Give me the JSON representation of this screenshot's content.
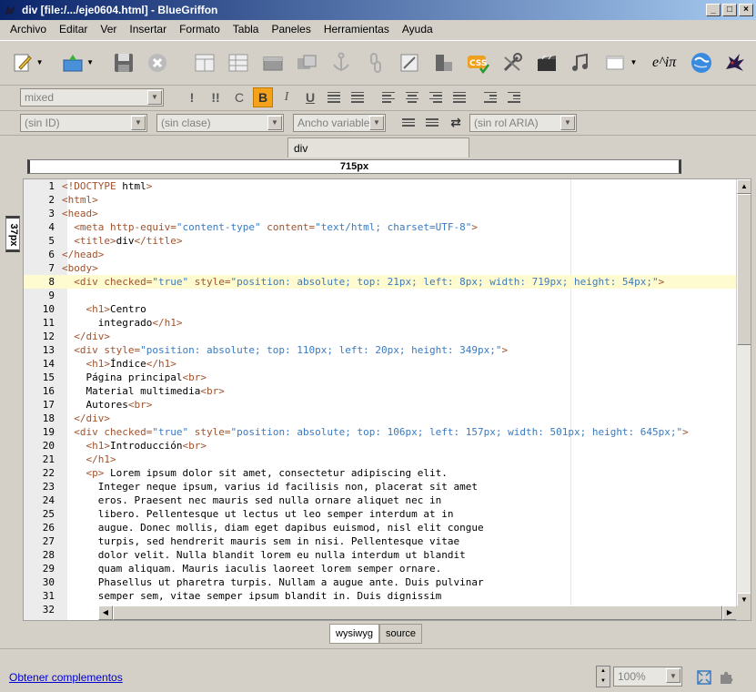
{
  "window": {
    "title": "div [file:/.../eje0604.html] - BlueGriffon"
  },
  "menu": [
    "Archivo",
    "Editar",
    "Ver",
    "Insertar",
    "Formato",
    "Tabla",
    "Paneles",
    "Herramientas",
    "Ayuda"
  ],
  "toolbar": {
    "icons": [
      "new-document-icon",
      "open-document-icon",
      "save-icon",
      "stop-icon",
      "table-icon",
      "table-alt-icon",
      "image-icon",
      "form-icon",
      "anchor-icon",
      "link-icon",
      "edit-image-icon",
      "blocks-icon",
      "css-icon",
      "tools-icon",
      "video-icon",
      "music-icon",
      "window-icon",
      "math-icon",
      "globe-icon",
      "griffon-icon"
    ],
    "math_label": "e^iπ"
  },
  "format_bar": {
    "paragraph_select": "mixed",
    "bold": "B",
    "italic": "I",
    "underline": "U",
    "strong": "!",
    "emphasis": "!!",
    "code": "C"
  },
  "attr_bar": {
    "id_select": "(sin ID)",
    "class_select": "(sin clase)",
    "width_select": "Ancho variable",
    "aria_select": "(sin rol ARIA)"
  },
  "tabs": [
    {
      "label": "div"
    }
  ],
  "rulers": {
    "horizontal": "715px",
    "vertical": "37px"
  },
  "code_lines": [
    {
      "n": "1",
      "text": "<!DOCTYPE html>"
    },
    {
      "n": "2",
      "text": "<html>"
    },
    {
      "n": "3",
      "text": "<head>"
    },
    {
      "n": "4",
      "text": "  <meta http-equiv=\"content-type\" content=\"text/html; charset=UTF-8\">"
    },
    {
      "n": "5",
      "text": "  <title>div</title>"
    },
    {
      "n": "6",
      "text": "</head>"
    },
    {
      "n": "7",
      "text": "<body>"
    },
    {
      "n": "8",
      "text": "  <div checked=\"true\" style=\"position: absolute; top: 21px; left: 8px; width: 719px; height: 54px;\">"
    },
    {
      "n": "9",
      "text": ""
    },
    {
      "n": "10",
      "text": "    <h1>Centro"
    },
    {
      "n": "11",
      "text": "      integrado</h1>"
    },
    {
      "n": "12",
      "text": "  </div>"
    },
    {
      "n": "13",
      "text": "  <div style=\"position: absolute; top: 110px; left: 20px; height: 349px;\">"
    },
    {
      "n": "14",
      "text": "    <h1>Índice</h1>"
    },
    {
      "n": "15",
      "text": "    Página principal<br>"
    },
    {
      "n": "16",
      "text": "    Material multimedia<br>"
    },
    {
      "n": "17",
      "text": "    Autores<br>"
    },
    {
      "n": "18",
      "text": "  </div>"
    },
    {
      "n": "19",
      "text": "  <div checked=\"true\" style=\"position: absolute; top: 106px; left: 157px; width: 501px; height: 645px;\">"
    },
    {
      "n": "20",
      "text": "    <h1>Introducción<br>"
    },
    {
      "n": "21",
      "text": "    </h1>"
    },
    {
      "n": "22",
      "text": "    <p> Lorem ipsum dolor sit amet, consectetur adipiscing elit."
    },
    {
      "n": "23",
      "text": "      Integer neque ipsum, varius id facilisis non, placerat sit amet"
    },
    {
      "n": "24",
      "text": "      eros. Praesent nec mauris sed nulla ornare aliquet nec in"
    },
    {
      "n": "25",
      "text": "      libero. Pellentesque ut lectus ut leo semper interdum at in"
    },
    {
      "n": "26",
      "text": "      augue. Donec mollis, diam eget dapibus euismod, nisl elit congue"
    },
    {
      "n": "27",
      "text": "      turpis, sed hendrerit mauris sem in nisi. Pellentesque vitae"
    },
    {
      "n": "28",
      "text": "      dolor velit. Nulla blandit lorem eu nulla interdum ut blandit"
    },
    {
      "n": "29",
      "text": "      quam aliquam. Mauris iaculis laoreet lorem semper ornare."
    },
    {
      "n": "30",
      "text": "      Phasellus ut pharetra turpis. Nullam a augue ante. Duis pulvinar"
    },
    {
      "n": "31",
      "text": "      semper sem, vitae semper ipsum blandit in. Duis dignissim"
    },
    {
      "n": "32",
      "text": ""
    }
  ],
  "view_modes": {
    "wysiwyg": "wysiwyg",
    "source": "source"
  },
  "status": {
    "addons_link": "Obtener complementos",
    "zoom": "100%"
  }
}
